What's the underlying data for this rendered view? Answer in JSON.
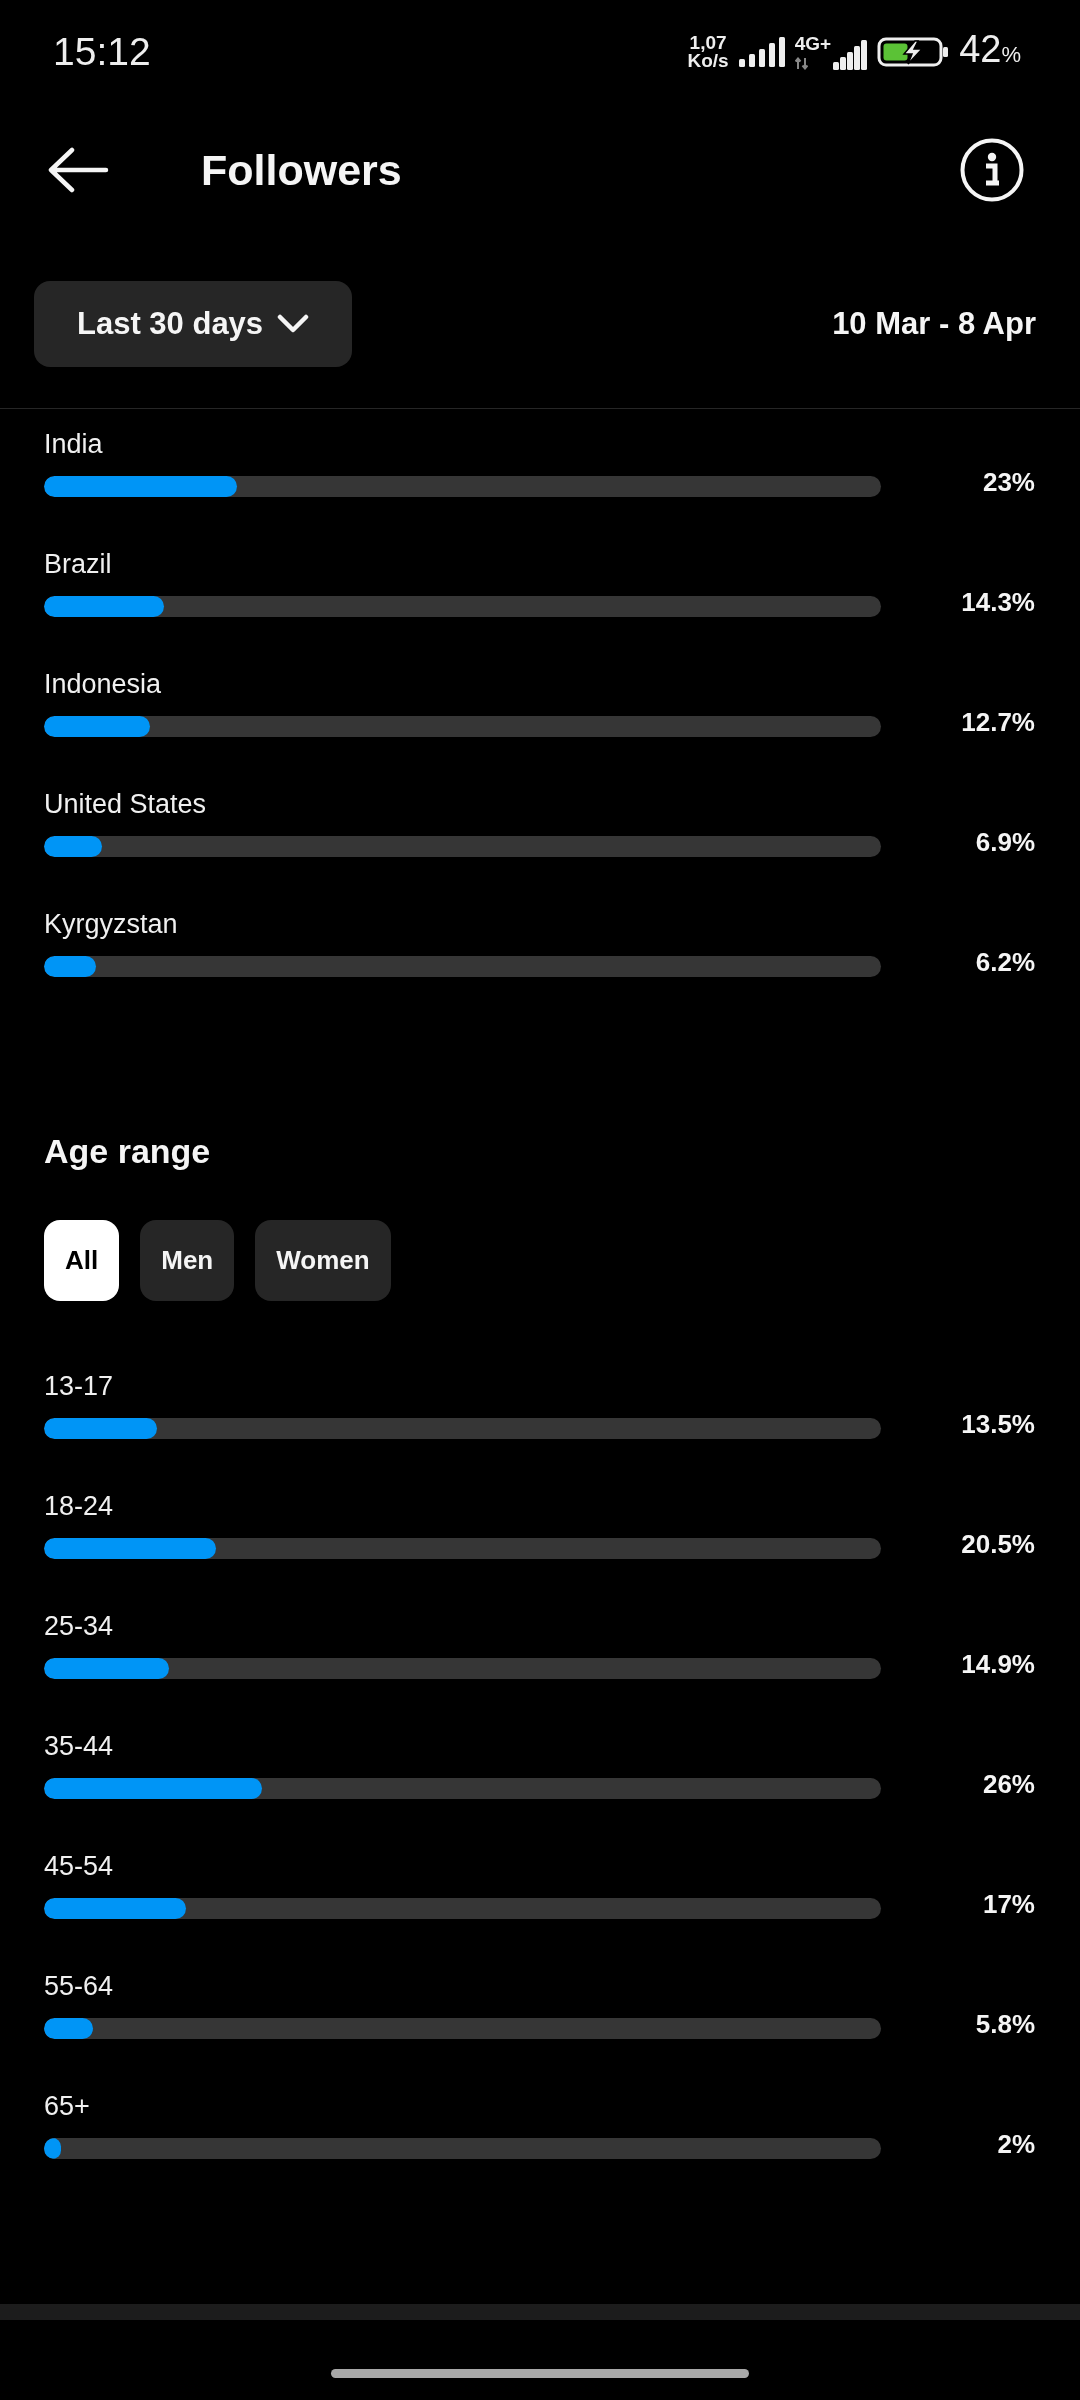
{
  "status_bar": {
    "time": "15:12",
    "net_speed": "1,07",
    "net_speed_unit": "Ko/s",
    "network_type": "4G+",
    "battery": "42",
    "battery_unit": "%"
  },
  "header": {
    "title": "Followers"
  },
  "filter": {
    "period": "Last 30 days",
    "date_range": "10 Mar - 8 Apr"
  },
  "countries": [
    {
      "name": "India",
      "level": 0.23,
      "reading": "23%"
    },
    {
      "name": "Brazil",
      "level": 0.143,
      "reading": "14.3%"
    },
    {
      "name": "Indonesia",
      "level": 0.127,
      "reading": "12.7%"
    },
    {
      "name": "United States",
      "level": 0.069,
      "reading": "6.9%"
    },
    {
      "name": "Kyrgyzstan",
      "level": 0.062,
      "reading": "6.2%"
    }
  ],
  "age_range": {
    "title": "Age range",
    "segments": [
      {
        "label": "All",
        "selected": true
      },
      {
        "label": "Men",
        "selected": false
      },
      {
        "label": "Women",
        "selected": false
      }
    ],
    "groups": [
      {
        "name": "13-17",
        "level": 0.135,
        "reading": "13.5%"
      },
      {
        "name": "18-24",
        "level": 0.205,
        "reading": "20.5%"
      },
      {
        "name": "25-34",
        "level": 0.149,
        "reading": "14.9%"
      },
      {
        "name": "35-44",
        "level": 0.26,
        "reading": "26%"
      },
      {
        "name": "45-54",
        "level": 0.17,
        "reading": "17%"
      },
      {
        "name": "55-64",
        "level": 0.058,
        "reading": "5.8%"
      },
      {
        "name": "65+",
        "level": 0.02,
        "reading": "2%"
      }
    ]
  }
}
